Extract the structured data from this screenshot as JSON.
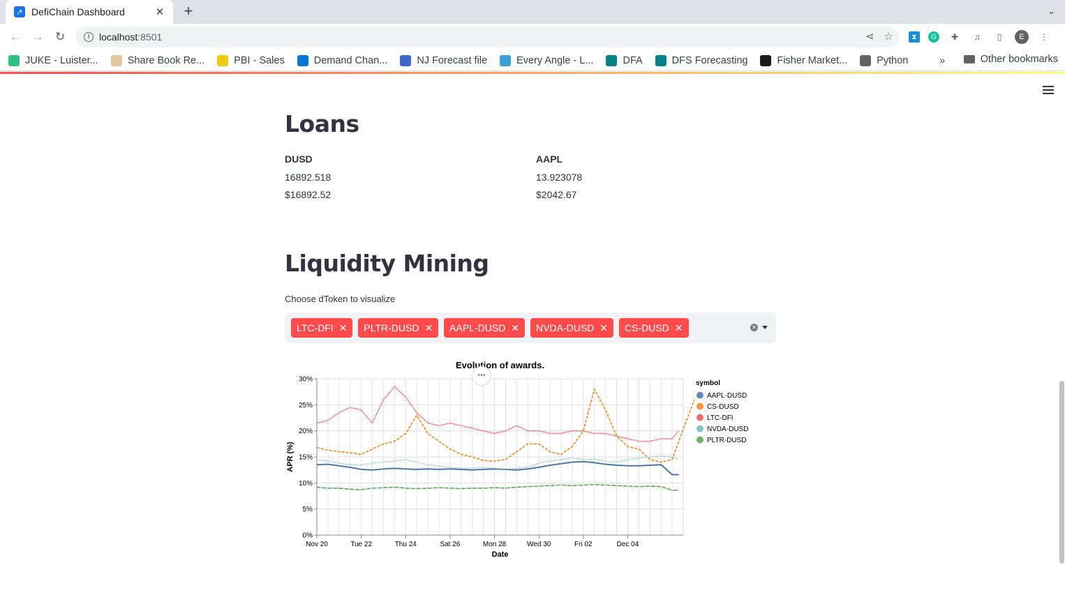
{
  "browser": {
    "tab_title": "DefiChain Dashboard",
    "url_host": "localhost",
    "url_port": ":8501",
    "profile_initial": "E",
    "bookmarks": [
      {
        "label": "JUKE - Luister...",
        "color": "#2ec27e"
      },
      {
        "label": "Share Book Re...",
        "color": "#e0c9a0"
      },
      {
        "label": "PBI - Sales",
        "color": "#f2c811"
      },
      {
        "label": "Demand Chan...",
        "color": "#0078d4"
      },
      {
        "label": "NJ Forecast file",
        "color": "#3d66c9"
      },
      {
        "label": "Every Angle - L...",
        "color": "#3aa0d8"
      },
      {
        "label": "DFA",
        "color": "#038387"
      },
      {
        "label": "DFS Forecasting",
        "color": "#038387"
      },
      {
        "label": "Fisher Market...",
        "color": "#1b1b1b"
      },
      {
        "label": "Python",
        "color": "#5f6368"
      }
    ],
    "bookmarks_more": "»",
    "other_bookmarks": "Other bookmarks"
  },
  "loans": {
    "title": "Loans",
    "columns": [
      {
        "label": "DUSD",
        "amount": "16892.518",
        "usd": "$16892.52"
      },
      {
        "label": "AAPL",
        "amount": "13.923078",
        "usd": "$2042.67"
      }
    ]
  },
  "liquidity": {
    "title": "Liquidity Mining",
    "select_label": "Choose dToken to visualize",
    "selected": [
      "LTC-DFI",
      "PLTR-DUSD",
      "AAPL-DUSD",
      "NVDA-DUSD",
      "CS-DUSD"
    ],
    "chip_color": "#ff4b4b"
  },
  "chart_data": {
    "type": "line",
    "title": "Evolution of awards.",
    "xlabel": "Date",
    "ylabel": "APR (%)",
    "x_ticks": [
      "Nov 20",
      "Tue 22",
      "Thu 24",
      "Sat 26",
      "Mon 28",
      "Wed 30",
      "Fri 02",
      "Dec 04"
    ],
    "y_ticks": [
      "0%",
      "5%",
      "10%",
      "15%",
      "20%",
      "25%",
      "30%"
    ],
    "ylim": [
      0,
      30
    ],
    "grid": true,
    "legend_title": "symbol",
    "legend_position": "right",
    "x_days": [
      0,
      0.5,
      1,
      1.5,
      2,
      2.5,
      3,
      3.5,
      4,
      4.5,
      5,
      5.5,
      6,
      6.5,
      7,
      7.5,
      8,
      8.5,
      9,
      9.5,
      10,
      10.5,
      11,
      11.5,
      12,
      12.5,
      13,
      13.5,
      14,
      14.5,
      15,
      15.5,
      16,
      16.3
    ],
    "series": [
      {
        "name": "AAPL-DUSD",
        "color": "#4c78a8",
        "values": [
          13.5,
          13.6,
          13.3,
          13.0,
          12.6,
          12.5,
          12.7,
          12.8,
          12.7,
          12.6,
          12.7,
          12.6,
          12.7,
          12.6,
          12.5,
          12.6,
          12.7,
          12.6,
          12.5,
          12.7,
          13.0,
          13.4,
          13.7,
          14.0,
          14.1,
          13.9,
          13.6,
          13.4,
          13.3,
          13.3,
          13.4,
          13.5,
          11.6,
          11.6
        ]
      },
      {
        "name": "CS-DUSD",
        "color": "#f58518",
        "values": [
          16.8,
          16.3,
          16.0,
          15.8,
          15.5,
          16.5,
          17.5,
          18.0,
          19.5,
          23.0,
          19.5,
          18.0,
          16.5,
          15.5,
          15.0,
          14.3,
          14.2,
          14.5,
          16.0,
          17.5,
          17.5,
          16.0,
          15.5,
          17.0,
          20.0,
          28.0,
          24.0,
          19.0,
          17.0,
          16.5,
          14.5,
          14.0,
          14.5,
          18.0,
          26.0
        ]
      },
      {
        "name": "LTC-DFI",
        "color": "#e45756",
        "values": [
          21.5,
          22.0,
          23.5,
          24.5,
          24.0,
          21.5,
          26.0,
          28.5,
          26.5,
          23.5,
          21.5,
          21.0,
          21.5,
          21.0,
          20.5,
          20.0,
          19.5,
          20.0,
          21.0,
          20.0,
          20.0,
          19.5,
          19.5,
          20.0,
          20.0,
          19.5,
          19.5,
          19.0,
          18.5,
          18.0,
          18.0,
          18.5,
          18.5,
          20.0
        ]
      },
      {
        "name": "NVDA-DUSD",
        "color": "#72b7b2",
        "values": [
          14.5,
          14.2,
          13.8,
          13.5,
          13.5,
          13.8,
          14.0,
          14.2,
          14.5,
          14.0,
          13.5,
          13.2,
          13.0,
          12.8,
          12.8,
          13.0,
          12.8,
          12.6,
          12.8,
          13.0,
          13.8,
          14.2,
          14.5,
          14.8,
          14.5,
          14.6,
          14.2,
          14.0,
          14.5,
          14.8,
          15.0,
          15.2,
          15.0,
          14.5
        ]
      },
      {
        "name": "PLTR-DUSD",
        "color": "#54a24b",
        "values": [
          9.2,
          9.0,
          9.0,
          8.8,
          8.7,
          9.0,
          9.1,
          9.2,
          9.0,
          8.9,
          9.0,
          9.1,
          9.0,
          8.9,
          9.0,
          9.0,
          9.1,
          9.0,
          9.2,
          9.3,
          9.4,
          9.5,
          9.6,
          9.5,
          9.6,
          9.7,
          9.6,
          9.5,
          9.4,
          9.3,
          9.4,
          9.3,
          8.6,
          8.6
        ]
      }
    ]
  }
}
